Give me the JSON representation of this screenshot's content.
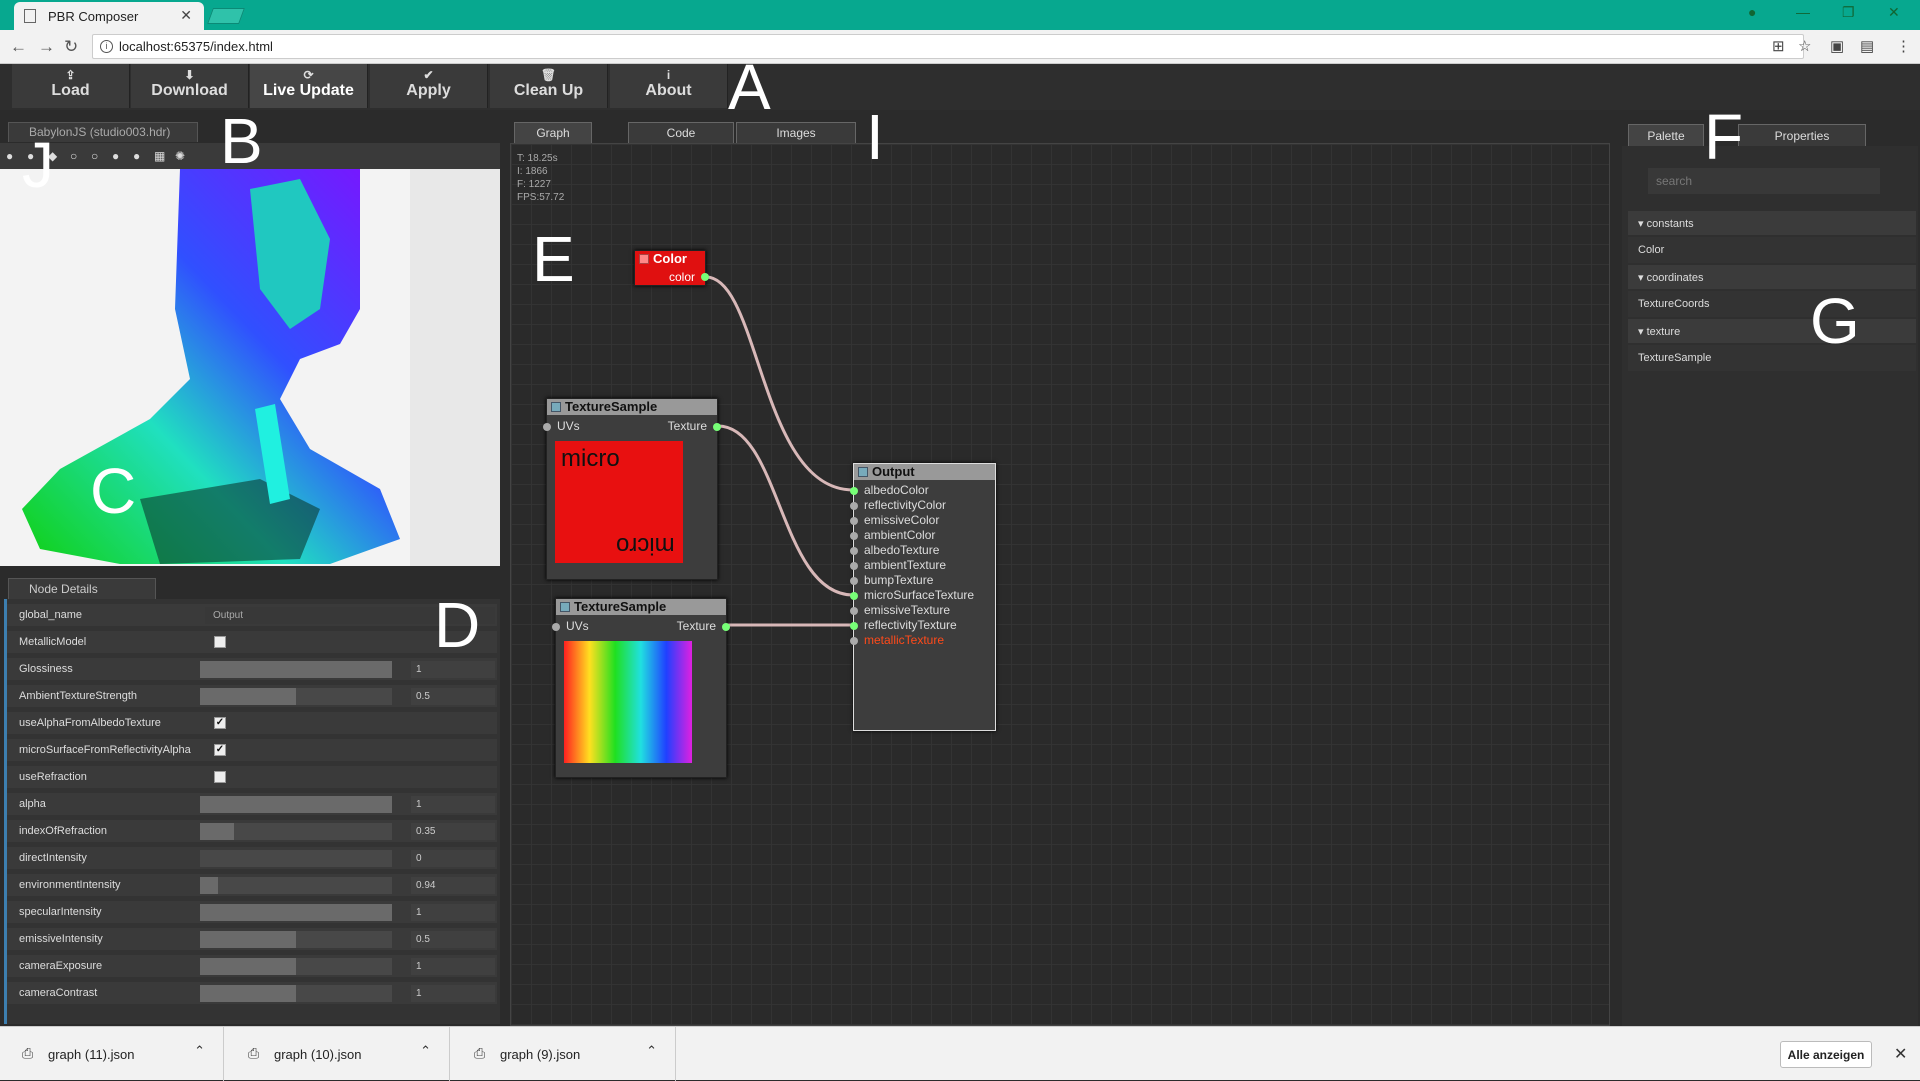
{
  "browser": {
    "tab_title": "PBR Composer",
    "url": "localhost:65375/index.html"
  },
  "toolbar": {
    "buttons": [
      {
        "label": "Load",
        "icon": "upload-icon"
      },
      {
        "label": "Download",
        "icon": "download-icon"
      },
      {
        "label": "Live Update",
        "icon": "refresh-icon",
        "active": true
      },
      {
        "label": "Apply",
        "icon": "check-circle-icon"
      },
      {
        "label": "Clean Up",
        "icon": "trash-icon"
      },
      {
        "label": "About",
        "icon": "info-icon"
      }
    ]
  },
  "annotations": [
    "A",
    "B",
    "C",
    "D",
    "E",
    "F",
    "G",
    "I",
    "J"
  ],
  "viewer": {
    "tab_label": "BabylonJS (studio003.hdr)"
  },
  "node_details": {
    "tab_label": "Node Details",
    "rows": [
      {
        "label": "global_name",
        "type": "text",
        "value": "Output"
      },
      {
        "label": "MetallicModel",
        "type": "checkbox",
        "checked": false
      },
      {
        "label": "Glossiness",
        "type": "slider",
        "fill": 1.0,
        "value": "1"
      },
      {
        "label": "AmbientTextureStrength",
        "type": "slider",
        "fill": 0.5,
        "value": "0.5"
      },
      {
        "label": "useAlphaFromAlbedoTexture",
        "type": "checkbox",
        "checked": true
      },
      {
        "label": "microSurfaceFromReflectivityAlpha",
        "type": "checkbox",
        "checked": true
      },
      {
        "label": "useRefraction",
        "type": "checkbox",
        "checked": false
      },
      {
        "label": "alpha",
        "type": "slider",
        "fill": 1.0,
        "value": "1"
      },
      {
        "label": "indexOfRefraction",
        "type": "slider",
        "fill": 0.175,
        "value": "0.35"
      },
      {
        "label": "directIntensity",
        "type": "slider",
        "fill": 0.0,
        "value": "0"
      },
      {
        "label": "environmentIntensity",
        "type": "slider",
        "fill": 0.094,
        "value": "0.94"
      },
      {
        "label": "specularIntensity",
        "type": "slider",
        "fill": 1.0,
        "value": "1"
      },
      {
        "label": "emissiveIntensity",
        "type": "slider",
        "fill": 0.5,
        "value": "0.5"
      },
      {
        "label": "cameraExposure",
        "type": "slider",
        "fill": 0.5,
        "value": "1"
      },
      {
        "label": "cameraContrast",
        "type": "slider",
        "fill": 0.5,
        "value": "1"
      }
    ]
  },
  "graph": {
    "tabs": [
      "Graph",
      "Code",
      "Images"
    ],
    "stats": [
      "T: 18.25s",
      "I: 1866",
      "F: 1227",
      "FPS:57.72"
    ],
    "color_node": {
      "title": "Color",
      "output": "color"
    },
    "texture_node_1": {
      "title": "TextureSample",
      "input": "UVs",
      "output": "Texture",
      "preview_text": "micro"
    },
    "texture_node_2": {
      "title": "TextureSample",
      "input": "UVs",
      "output": "Texture"
    },
    "output_node": {
      "title": "Output",
      "inputs": [
        "albedoColor",
        "reflectivityColor",
        "emissiveColor",
        "ambientColor",
        "albedoTexture",
        "ambientTexture",
        "bumpTexture",
        "microSurfaceTexture",
        "emissiveTexture",
        "reflectivityTexture",
        "metallicTexture"
      ]
    }
  },
  "right_panel": {
    "tabs": [
      "Palette",
      "Properties"
    ],
    "search_placeholder": "search",
    "categories": [
      {
        "name": "constants",
        "items": [
          "Color"
        ]
      },
      {
        "name": "coordinates",
        "items": [
          "TextureCoords"
        ]
      },
      {
        "name": "texture",
        "items": [
          "TextureSample"
        ]
      }
    ]
  },
  "downloads": {
    "files": [
      "graph (11).json",
      "graph (10).json",
      "graph (9).json"
    ],
    "show_all": "Alle anzeigen"
  },
  "colors": {
    "browser_accent": "#07a88f",
    "connected_port": "#77ff77",
    "highlight_input": "#ff4a1a",
    "color_node": "#e01010"
  }
}
